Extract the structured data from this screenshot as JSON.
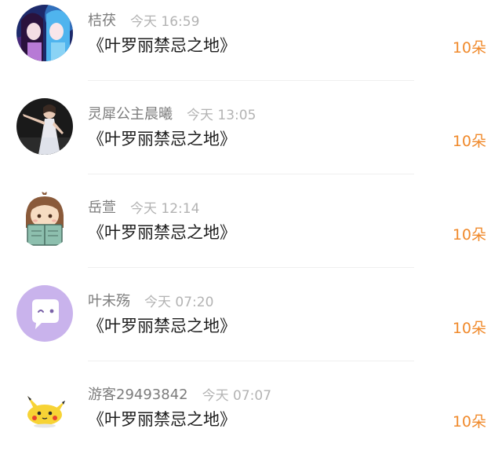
{
  "colors": {
    "accent": "#f08a2c",
    "name_text": "#7c7c7c",
    "time_text": "#b3b3b3",
    "title_text": "#1e1e1e"
  },
  "entries": [
    {
      "name": "桔茯",
      "time": "今天 16:59",
      "title": "《叶罗丽禁忌之地》",
      "amount": "10朵",
      "avatar": "anime-dolls-avatar"
    },
    {
      "name": "灵犀公主晨曦",
      "time": "今天 13:05",
      "title": "《叶罗丽禁忌之地》",
      "amount": "10朵",
      "avatar": "dancer-photo-avatar"
    },
    {
      "name": "岳萱",
      "time": "今天 12:14",
      "title": "《叶罗丽禁忌之地》",
      "amount": "10朵",
      "avatar": "reading-girl-avatar"
    },
    {
      "name": "叶未殇",
      "time": "今天 07:20",
      "title": "《叶罗丽禁忌之地》",
      "amount": "10朵",
      "avatar": "chat-bubble-avatar"
    },
    {
      "name": "游客29493842",
      "time": "今天 07:07",
      "title": "《叶罗丽禁忌之地》",
      "amount": "10朵",
      "avatar": "pikachu-avatar"
    }
  ]
}
